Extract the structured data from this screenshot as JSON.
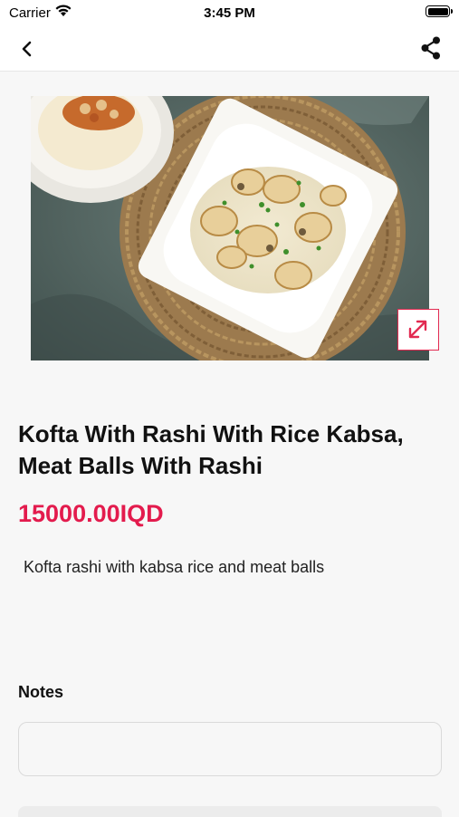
{
  "status_bar": {
    "carrier": "Carrier",
    "time": "3:45 PM"
  },
  "nav": {
    "back_icon": "chevron-left-icon",
    "share_icon": "share-icon"
  },
  "product": {
    "title": "Kofta With Rashi With Rice Kabsa, Meat Balls With Rashi",
    "price": "15000.00IQD",
    "description": "Kofta rashi with kabsa rice and meat balls",
    "image_icon": "expand-icon"
  },
  "notes": {
    "label": "Notes",
    "value": "",
    "placeholder": ""
  },
  "colors": {
    "accent": "#e31b4d",
    "background": "#f7f7f7"
  }
}
